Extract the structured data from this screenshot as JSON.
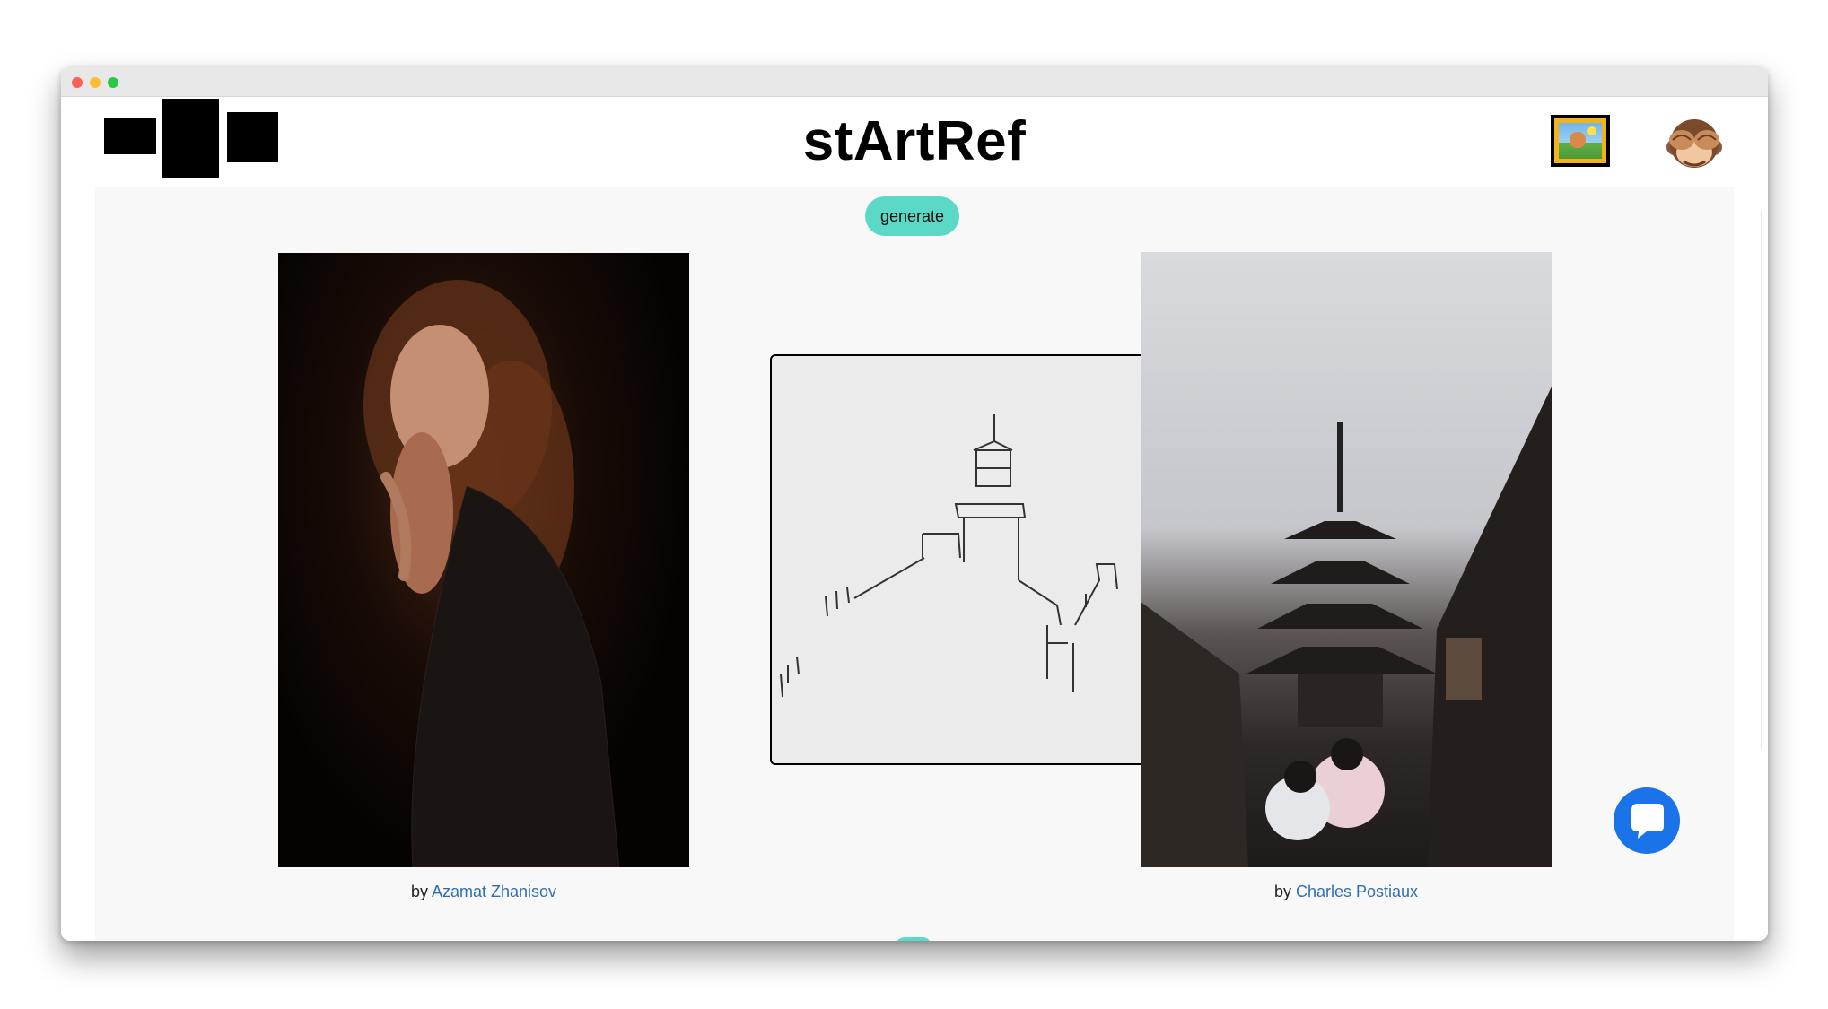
{
  "app": {
    "title": "stArtRef"
  },
  "toolbar": {
    "generate_label": "generate"
  },
  "header": {
    "logo_icon": "logo-blocks-icon",
    "gallery_icon": "framed-picture-icon",
    "profile_icon": "see-no-evil-monkey-icon"
  },
  "images": [
    {
      "kind": "photo",
      "subject": "portrait",
      "credit_prefix": "by",
      "credit_name": "Azamat Zhanisov"
    },
    {
      "kind": "sketch",
      "subject": "pencil sketch"
    },
    {
      "kind": "photo",
      "subject": "pagoda street",
      "credit_prefix": "by",
      "credit_name": "Charles Postiaux"
    }
  ],
  "chat": {
    "icon": "chat-bubble-icon"
  },
  "colors": {
    "accent": "#5cd8c6",
    "link": "#2f6fb1",
    "chat": "#1a73e8",
    "background": "#f8f8f8"
  }
}
